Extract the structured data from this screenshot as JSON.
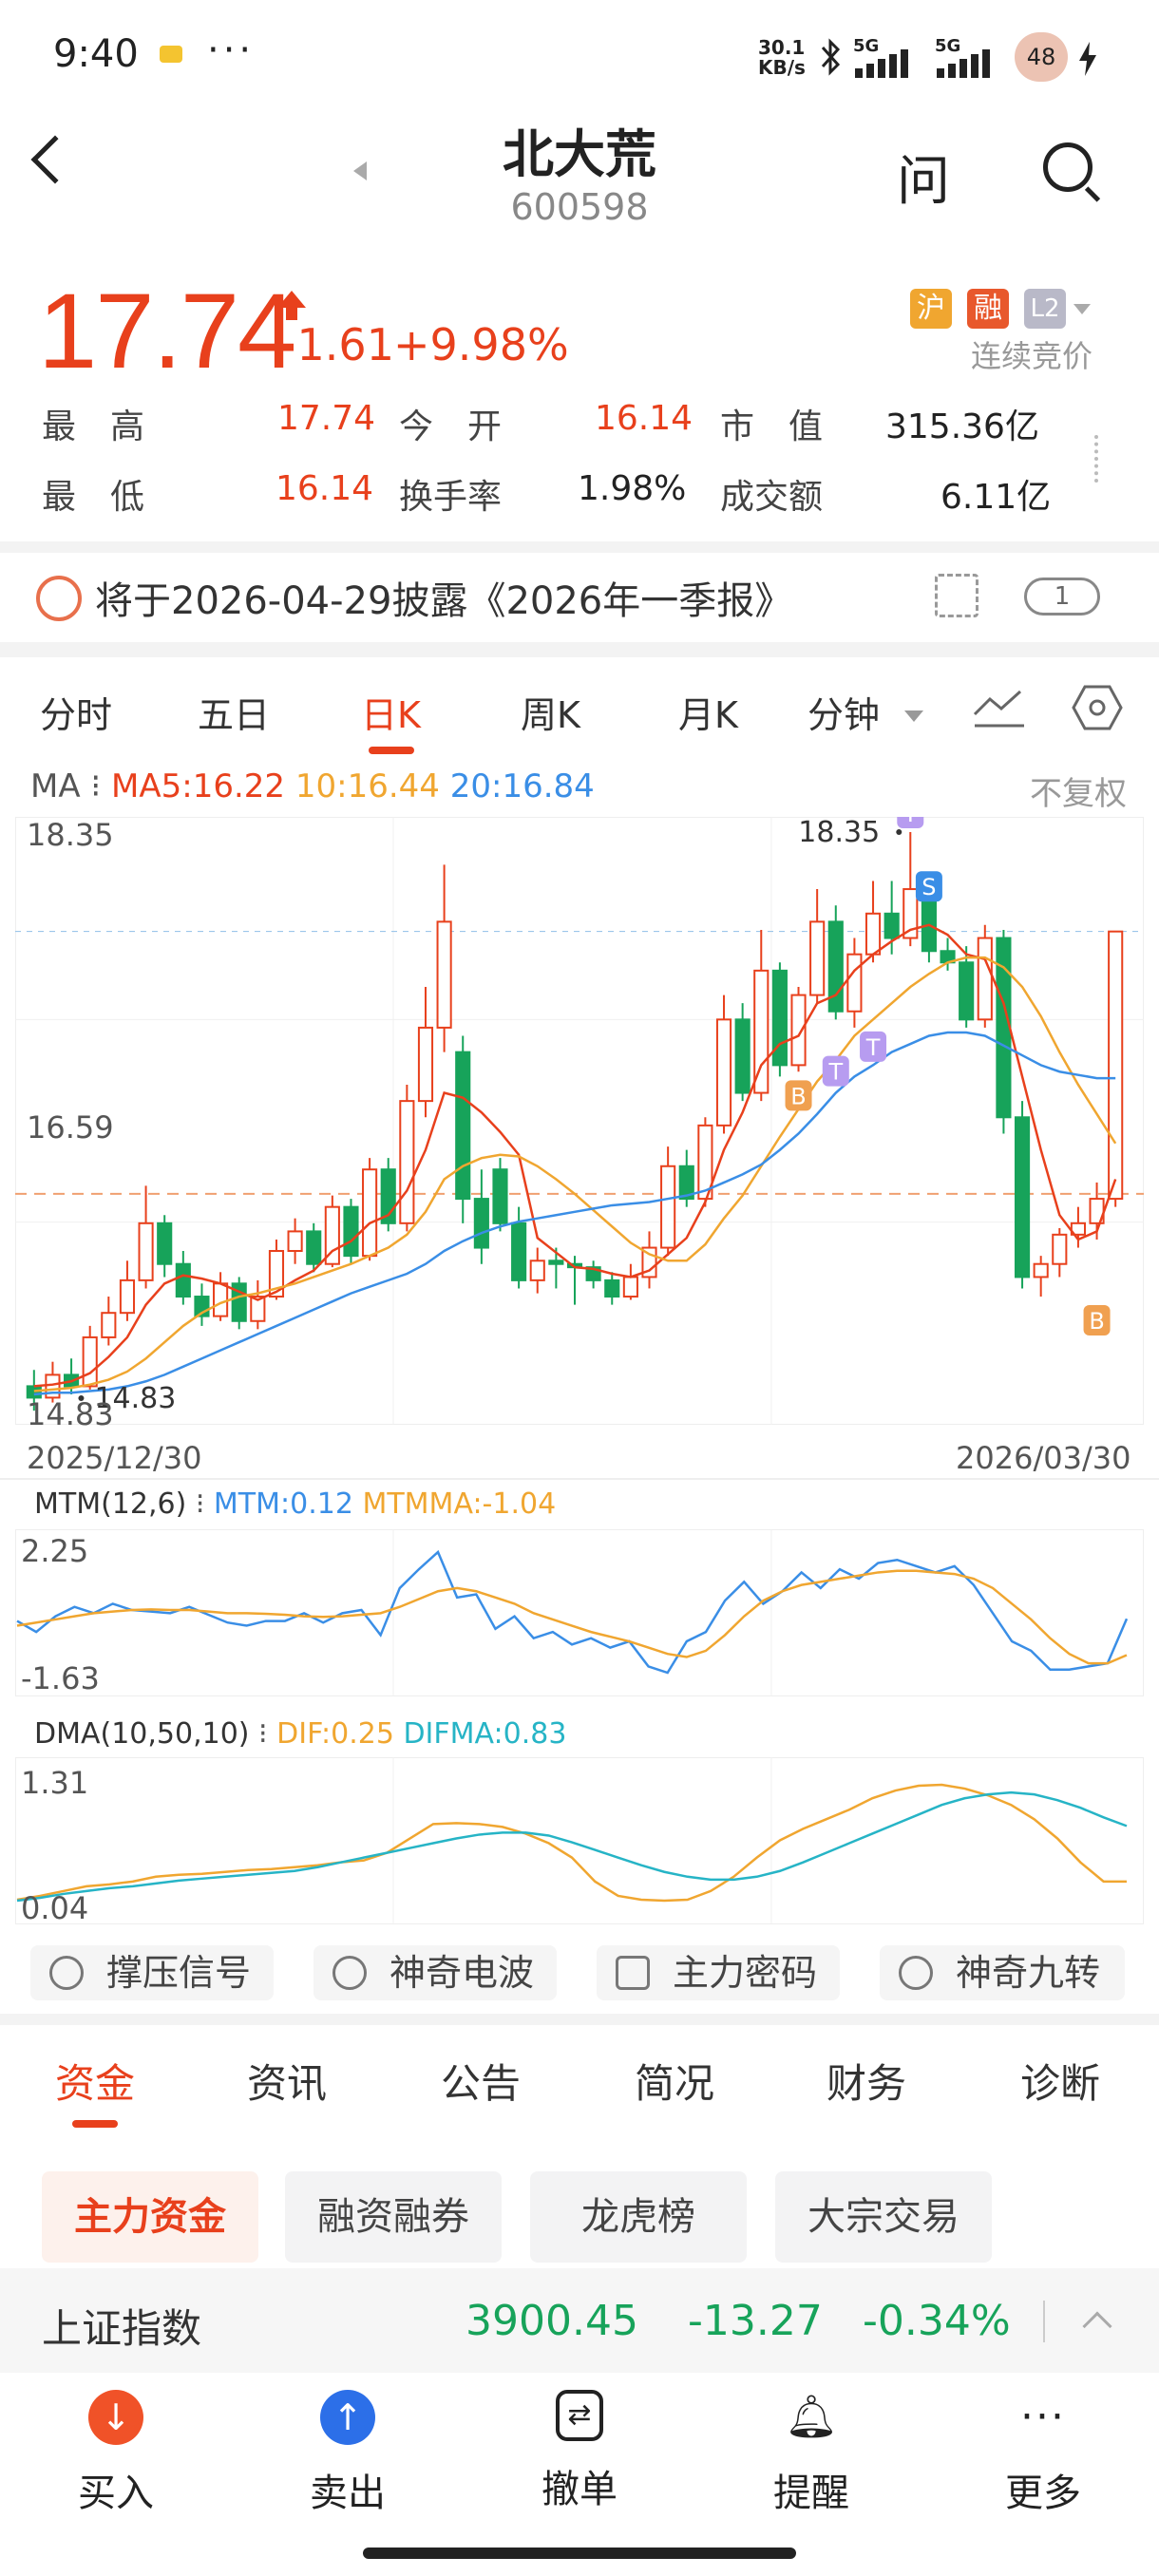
{
  "status_bar": {
    "time": "9:40",
    "dots": "···",
    "speed_top": "30.1",
    "speed_bottom": "KB/s",
    "net1": "5G",
    "net2": "5G",
    "battery": "48"
  },
  "header": {
    "title": "北大荒",
    "code": "600598",
    "ask_label": "问"
  },
  "quote": {
    "price": "17.74",
    "change": "+1.61",
    "change_pct": "+9.98%",
    "tags": [
      "沪",
      "融",
      "L2"
    ],
    "tag_colors": [
      "#f0a630",
      "#e8582c",
      "#b9b9c8"
    ],
    "auction_status": "连续竞价",
    "stats": [
      {
        "label": "最　高",
        "value": "17.74"
      },
      {
        "label": "今　开",
        "value": "16.14"
      },
      {
        "label": "市　值",
        "value": "315.36亿"
      },
      {
        "label": "最　低",
        "value": "16.14"
      },
      {
        "label": "换手率",
        "value": "1.98%"
      },
      {
        "label": "成交额",
        "value": "6.11亿"
      }
    ]
  },
  "notice": {
    "text": "将于2026-04-29披露《2026年一季报》",
    "badge": "1"
  },
  "chart_tabs": {
    "items": [
      "分时",
      "五日",
      "日K",
      "周K",
      "月K",
      "分钟"
    ],
    "active": "日K"
  },
  "ma_legend": {
    "prefix": "MA",
    "ma5": "MA5:16.22",
    "ma10": "10:16.44",
    "ma20": "20:16.84",
    "fq": "不复权"
  },
  "kline_axis": {
    "y_top": "18.35",
    "y_mid": "16.59",
    "y_bottom": "14.83",
    "high_label": "18.35",
    "low_label": "14.83",
    "date_start": "2025/12/30",
    "date_end": "2026/03/30"
  },
  "mtm_legend": {
    "name": "MTM(12,6)",
    "mtm": "MTM:0.12",
    "mtmma": "MTMMA:-1.04",
    "y_top": "2.25",
    "y_bottom": "-1.63"
  },
  "dma_legend": {
    "name": "DMA(10,50,10)",
    "dif": "DIF:0.25",
    "difma": "DIFMA:0.83",
    "y_top": "1.31",
    "y_bottom": "0.04"
  },
  "signals": [
    "撑压信号",
    "神奇电波",
    "主力密码",
    "神奇九转"
  ],
  "fund_tabs": {
    "items": [
      "资金",
      "资讯",
      "公告",
      "简况",
      "财务",
      "诊断"
    ],
    "active": "资金"
  },
  "sub_chips": {
    "items": [
      "主力资金",
      "融资融券",
      "龙虎榜",
      "大宗交易"
    ],
    "active": "主力资金"
  },
  "index_bar": {
    "name": "上证指数",
    "value": "3900.45",
    "change": "-13.27",
    "pct": "-0.34%"
  },
  "bottom_nav": [
    "买入",
    "卖出",
    "撤单",
    "提醒",
    "更多"
  ],
  "colors": {
    "up": "#e8401c",
    "down": "#17a35a",
    "ma5": "#e8401c",
    "ma10": "#f0a630",
    "ma20": "#3a8ee6"
  },
  "chart_data": [
    {
      "type": "candlestick",
      "title": "",
      "ylim": [
        14.83,
        18.35
      ],
      "x_range": [
        "2025/12/30",
        "2026/03/30"
      ],
      "candles": [
        [
          14.95,
          14.88,
          15.05,
          14.8
        ],
        [
          14.88,
          15.02,
          15.1,
          14.85
        ],
        [
          15.02,
          14.95,
          15.12,
          14.9
        ],
        [
          14.95,
          15.25,
          15.32,
          14.93
        ],
        [
          15.25,
          15.4,
          15.5,
          15.2
        ],
        [
          15.4,
          15.6,
          15.72,
          15.35
        ],
        [
          15.6,
          15.95,
          16.18,
          15.55
        ],
        [
          15.95,
          15.7,
          16.0,
          15.62
        ],
        [
          15.7,
          15.5,
          15.78,
          15.45
        ],
        [
          15.5,
          15.38,
          15.58,
          15.32
        ],
        [
          15.38,
          15.58,
          15.65,
          15.35
        ],
        [
          15.58,
          15.35,
          15.62,
          15.3
        ],
        [
          15.35,
          15.5,
          15.6,
          15.3
        ],
        [
          15.5,
          15.78,
          15.85,
          15.48
        ],
        [
          15.78,
          15.9,
          15.98,
          15.7
        ],
        [
          15.9,
          15.7,
          15.95,
          15.65
        ],
        [
          15.7,
          16.05,
          16.12,
          15.68
        ],
        [
          16.05,
          15.75,
          16.1,
          15.7
        ],
        [
          15.75,
          16.28,
          16.35,
          15.72
        ],
        [
          16.28,
          15.95,
          16.35,
          15.9
        ],
        [
          15.95,
          16.7,
          16.8,
          15.9
        ],
        [
          16.7,
          17.15,
          17.4,
          16.6
        ],
        [
          17.15,
          17.8,
          18.15,
          17.0
        ],
        [
          17.0,
          16.1,
          17.1,
          15.95
        ],
        [
          16.1,
          15.8,
          16.28,
          15.7
        ],
        [
          16.28,
          15.95,
          16.35,
          15.9
        ],
        [
          15.95,
          15.6,
          16.05,
          15.55
        ],
        [
          15.6,
          15.72,
          15.8,
          15.52
        ],
        [
          15.72,
          15.7,
          15.8,
          15.55
        ],
        [
          15.7,
          15.68,
          15.75,
          15.45
        ],
        [
          15.68,
          15.6,
          15.72,
          15.55
        ],
        [
          15.6,
          15.5,
          15.65,
          15.45
        ],
        [
          15.5,
          15.62,
          15.7,
          15.48
        ],
        [
          15.62,
          15.8,
          15.9,
          15.55
        ],
        [
          15.8,
          16.3,
          16.42,
          15.75
        ],
        [
          16.3,
          16.1,
          16.4,
          16.05
        ],
        [
          16.1,
          16.55,
          16.6,
          16.05
        ],
        [
          16.55,
          17.2,
          17.35,
          16.5
        ],
        [
          17.2,
          16.75,
          17.3,
          16.7
        ],
        [
          16.75,
          17.5,
          17.75,
          16.7
        ],
        [
          17.5,
          16.92,
          17.55,
          16.85
        ],
        [
          16.92,
          17.35,
          17.4,
          16.88
        ],
        [
          17.35,
          17.8,
          18.0,
          17.3
        ],
        [
          17.8,
          17.25,
          17.9,
          17.2
        ],
        [
          17.25,
          17.6,
          17.7,
          17.15
        ],
        [
          17.6,
          17.85,
          18.05,
          17.55
        ],
        [
          17.85,
          17.7,
          18.05,
          17.6
        ],
        [
          17.7,
          18.0,
          18.35,
          17.65
        ],
        [
          18.0,
          17.62,
          18.1,
          17.55
        ],
        [
          17.62,
          17.55,
          17.7,
          17.5
        ],
        [
          17.55,
          17.2,
          17.65,
          17.15
        ],
        [
          17.2,
          17.7,
          17.78,
          17.15
        ],
        [
          17.7,
          16.6,
          17.75,
          16.5
        ],
        [
          16.6,
          15.62,
          16.7,
          15.55
        ],
        [
          15.62,
          15.7,
          15.75,
          15.5
        ],
        [
          15.7,
          15.88,
          15.92,
          15.62
        ],
        [
          15.88,
          15.95,
          16.05,
          15.8
        ],
        [
          15.95,
          16.1,
          16.2,
          15.85
        ],
        [
          16.1,
          17.74,
          17.74,
          16.05
        ]
      ],
      "ma5": [
        14.95,
        14.96,
        14.98,
        15.03,
        15.13,
        15.25,
        15.45,
        15.58,
        15.63,
        15.61,
        15.58,
        15.53,
        15.48,
        15.53,
        15.6,
        15.66,
        15.78,
        15.84,
        15.95,
        16.0,
        16.15,
        16.4,
        16.75,
        16.72,
        16.63,
        16.51,
        16.37,
        15.86,
        15.77,
        15.68,
        15.67,
        15.64,
        15.62,
        15.66,
        15.76,
        15.86,
        16.08,
        16.4,
        16.63,
        16.92,
        17.05,
        17.1,
        17.3,
        17.35,
        17.5,
        17.6,
        17.68,
        17.75,
        17.78,
        17.72,
        17.6,
        17.57,
        17.3,
        16.85,
        16.4,
        16.0,
        15.85,
        15.9,
        16.22
      ],
      "ma10": [
        14.92,
        14.93,
        14.94,
        14.96,
        14.99,
        15.04,
        15.12,
        15.22,
        15.32,
        15.4,
        15.46,
        15.5,
        15.52,
        15.55,
        15.58,
        15.62,
        15.66,
        15.7,
        15.75,
        15.8,
        15.88,
        16.02,
        16.22,
        16.3,
        16.35,
        16.37,
        16.36,
        16.3,
        16.22,
        16.13,
        16.03,
        15.93,
        15.83,
        15.76,
        15.72,
        15.72,
        15.82,
        15.98,
        16.12,
        16.3,
        16.48,
        16.65,
        16.82,
        16.95,
        17.1,
        17.2,
        17.3,
        17.4,
        17.48,
        17.55,
        17.58,
        17.58,
        17.52,
        17.4,
        17.22,
        17.0,
        16.8,
        16.62,
        16.44
      ],
      "ma20": [
        14.9,
        14.91,
        14.91,
        14.92,
        14.93,
        14.95,
        14.98,
        15.02,
        15.07,
        15.12,
        15.17,
        15.22,
        15.27,
        15.32,
        15.37,
        15.42,
        15.47,
        15.52,
        15.56,
        15.6,
        15.64,
        15.7,
        15.78,
        15.84,
        15.89,
        15.93,
        15.96,
        15.98,
        16.0,
        16.02,
        16.04,
        16.06,
        16.07,
        16.08,
        16.1,
        16.12,
        16.15,
        16.2,
        16.25,
        16.31,
        16.4,
        16.5,
        16.62,
        16.75,
        16.85,
        16.92,
        17.0,
        17.05,
        17.1,
        17.12,
        17.12,
        17.1,
        17.04,
        16.98,
        16.92,
        16.88,
        16.86,
        16.84,
        16.84
      ]
    },
    {
      "type": "line",
      "title": "MTM(12,6)",
      "ylim": [
        -1.63,
        2.25
      ],
      "series": [
        {
          "name": "MTM",
          "values": [
            0.05,
            -0.3,
            0.2,
            0.5,
            0.3,
            0.6,
            0.4,
            0.35,
            0.3,
            0.5,
            0.25,
            0.0,
            -0.1,
            0.05,
            0.05,
            0.3,
            0.0,
            0.3,
            0.4,
            -0.4,
            1.1,
            1.7,
            2.25,
            0.8,
            0.9,
            -0.2,
            0.2,
            -0.5,
            -0.3,
            -0.7,
            -0.5,
            -0.8,
            -0.6,
            -1.4,
            -1.6,
            -0.6,
            -0.3,
            0.7,
            1.3,
            0.6,
            1.0,
            1.6,
            1.1,
            1.7,
            1.4,
            1.9,
            2.0,
            1.8,
            1.6,
            1.8,
            1.2,
            0.3,
            -0.6,
            -0.9,
            -1.5,
            -1.5,
            -1.4,
            -1.3,
            0.12
          ]
        },
        {
          "name": "MTMMA",
          "values": [
            -0.1,
            0.0,
            0.1,
            0.2,
            0.3,
            0.35,
            0.4,
            0.42,
            0.4,
            0.4,
            0.35,
            0.3,
            0.3,
            0.28,
            0.25,
            0.2,
            0.18,
            0.2,
            0.25,
            0.3,
            0.5,
            0.75,
            1.0,
            1.1,
            1.0,
            0.8,
            0.6,
            0.3,
            0.1,
            -0.1,
            -0.3,
            -0.45,
            -0.6,
            -0.8,
            -1.0,
            -1.1,
            -0.9,
            -0.4,
            0.2,
            0.7,
            1.0,
            1.2,
            1.3,
            1.4,
            1.5,
            1.6,
            1.65,
            1.65,
            1.6,
            1.55,
            1.4,
            1.1,
            0.6,
            0.1,
            -0.5,
            -1.0,
            -1.3,
            -1.3,
            -1.04
          ]
        }
      ]
    },
    {
      "type": "line",
      "title": "DMA(10,50,10)",
      "ylim": [
        0.04,
        1.31
      ],
      "series": [
        {
          "name": "DIF",
          "values": [
            0.06,
            0.1,
            0.15,
            0.2,
            0.22,
            0.25,
            0.3,
            0.32,
            0.33,
            0.35,
            0.37,
            0.38,
            0.4,
            0.42,
            0.45,
            0.47,
            0.55,
            0.7,
            0.85,
            0.86,
            0.85,
            0.82,
            0.75,
            0.65,
            0.5,
            0.25,
            0.1,
            0.06,
            0.05,
            0.06,
            0.15,
            0.3,
            0.5,
            0.68,
            0.8,
            0.9,
            1.0,
            1.12,
            1.2,
            1.25,
            1.26,
            1.22,
            1.15,
            1.05,
            0.9,
            0.7,
            0.45,
            0.25,
            0.25
          ]
        },
        {
          "name": "DIFMA",
          "values": [
            0.05,
            0.08,
            0.12,
            0.15,
            0.18,
            0.2,
            0.23,
            0.26,
            0.28,
            0.3,
            0.32,
            0.34,
            0.36,
            0.4,
            0.45,
            0.5,
            0.55,
            0.6,
            0.65,
            0.7,
            0.74,
            0.76,
            0.76,
            0.73,
            0.66,
            0.58,
            0.5,
            0.42,
            0.35,
            0.3,
            0.27,
            0.27,
            0.3,
            0.36,
            0.45,
            0.55,
            0.65,
            0.75,
            0.85,
            0.95,
            1.05,
            1.12,
            1.16,
            1.18,
            1.16,
            1.1,
            1.02,
            0.92,
            0.83
          ]
        }
      ]
    }
  ]
}
